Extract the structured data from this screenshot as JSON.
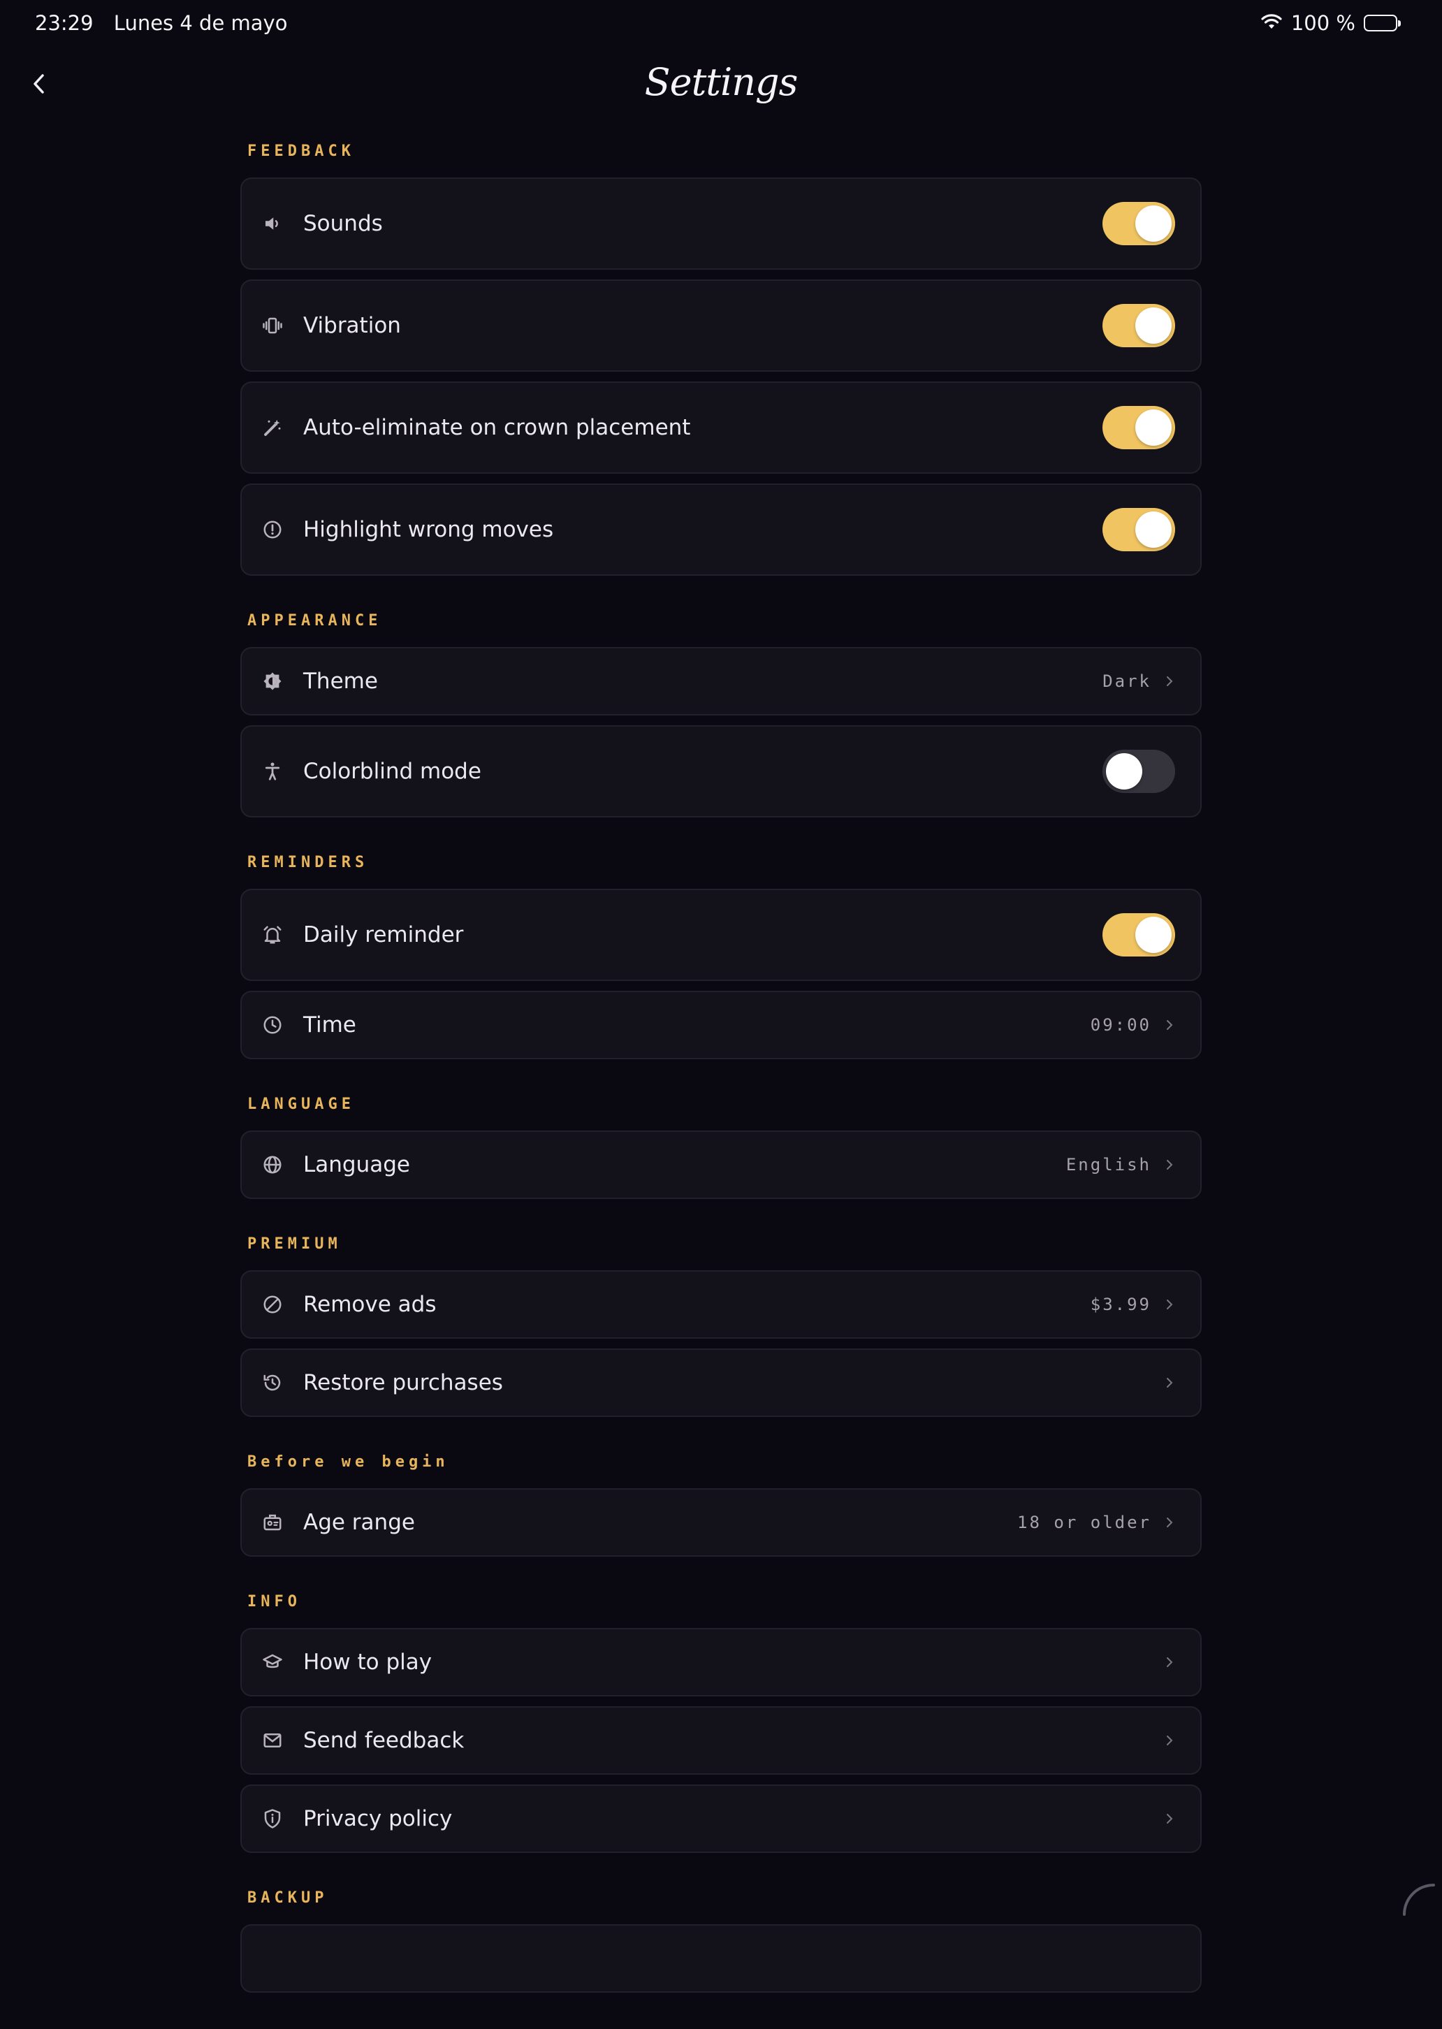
{
  "status_bar": {
    "time": "23:29",
    "date": "Lunes 4 de mayo",
    "battery": "100 %",
    "battery_level": 1.0
  },
  "header": {
    "title": "Settings",
    "back_icon": "chevron-left-icon"
  },
  "colors": {
    "accent": "#f1c462",
    "section_title": "#e8b55a",
    "background": "#0a0911",
    "card": "#13121a"
  },
  "sections": {
    "feedback": {
      "title": "FEEDBACK",
      "sounds": {
        "label": "Sounds",
        "icon": "speaker-icon",
        "on": true
      },
      "vibration": {
        "label": "Vibration",
        "icon": "vibration-icon",
        "on": true
      },
      "auto_eliminate": {
        "label": "Auto-eliminate on crown placement",
        "icon": "magic-wand-icon",
        "on": true
      },
      "highlight": {
        "label": "Highlight wrong moves",
        "icon": "alert-circle-icon",
        "on": true
      }
    },
    "appearance": {
      "title": "APPEARANCE",
      "theme": {
        "label": "Theme",
        "icon": "contrast-icon",
        "value": "Dark"
      },
      "colorblind": {
        "label": "Colorblind mode",
        "icon": "accessibility-icon",
        "on": false
      }
    },
    "reminders": {
      "title": "REMINDERS",
      "daily": {
        "label": "Daily reminder",
        "icon": "alarm-bell-icon",
        "on": true
      },
      "time": {
        "label": "Time",
        "icon": "clock-icon",
        "value": "09:00"
      }
    },
    "language": {
      "title": "LANGUAGE",
      "language": {
        "label": "Language",
        "icon": "globe-icon",
        "value": "English"
      }
    },
    "premium": {
      "title": "PREMIUM",
      "remove_ads": {
        "label": "Remove ads",
        "icon": "block-icon",
        "value": "$3.99"
      },
      "restore": {
        "label": "Restore purchases",
        "icon": "history-icon"
      }
    },
    "before": {
      "title": "Before we begin",
      "age": {
        "label": "Age range",
        "icon": "id-badge-icon",
        "value": "18 or older"
      }
    },
    "info": {
      "title": "INFO",
      "how_to_play": {
        "label": "How to play",
        "icon": "graduation-cap-icon"
      },
      "feedback": {
        "label": "Send feedback",
        "icon": "mail-icon"
      },
      "privacy": {
        "label": "Privacy policy",
        "icon": "shield-info-icon"
      }
    },
    "backup": {
      "title": "BACKUP"
    }
  }
}
